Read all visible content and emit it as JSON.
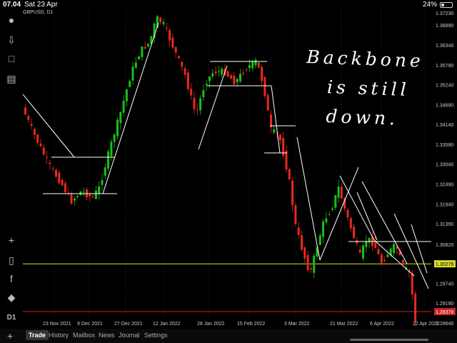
{
  "status": {
    "time": "07.04",
    "date": "Sat 23 Apr",
    "battery": "24%"
  },
  "chart": {
    "symbol": "GBPUSD, D1",
    "timeframe_label": "D1",
    "price_ticks": [
      "1.37230",
      "1.36890",
      "1.36340",
      "1.35790",
      "1.35240",
      "1.34690",
      "1.34140",
      "1.33590",
      "1.33040",
      "1.32490",
      "1.31940",
      "1.31390",
      "1.30820",
      "1.30279",
      "1.29740",
      "1.29190",
      "1.28640",
      "1.28378"
    ],
    "date_labels": [
      "23 Nov 2021",
      "9 Dec 2021",
      "27 Dec 2021",
      "12 Jan 2022",
      "28 Jan 2022",
      "15 Feb 2022",
      "3 Mar 2022",
      "21 Mar 2022",
      "6 Apr 2022",
      "22 Apr 2022"
    ],
    "current_price": "1.30279",
    "last_price": "1.28378",
    "colors": {
      "up": "#19c01a",
      "down": "#e8281e",
      "yellow": "#dcdc2c",
      "line": "#ffffff",
      "grid": "#2a2a2a"
    }
  },
  "annotation": {
    "line1": "Backbone",
    "line2": "is still",
    "line3": "down."
  },
  "tabs": {
    "trade": "Trade",
    "history": "History",
    "mailbox": "Mailbox",
    "news": "News",
    "journal": "Journal",
    "settings": "Settings"
  },
  "toolbar_icons": [
    "person-icon",
    "download-icon",
    "chat-icon",
    "document-icon",
    "crosshair-icon",
    "candles-icon",
    "function-icon",
    "shapes-icon",
    "timeframe-icon"
  ]
}
